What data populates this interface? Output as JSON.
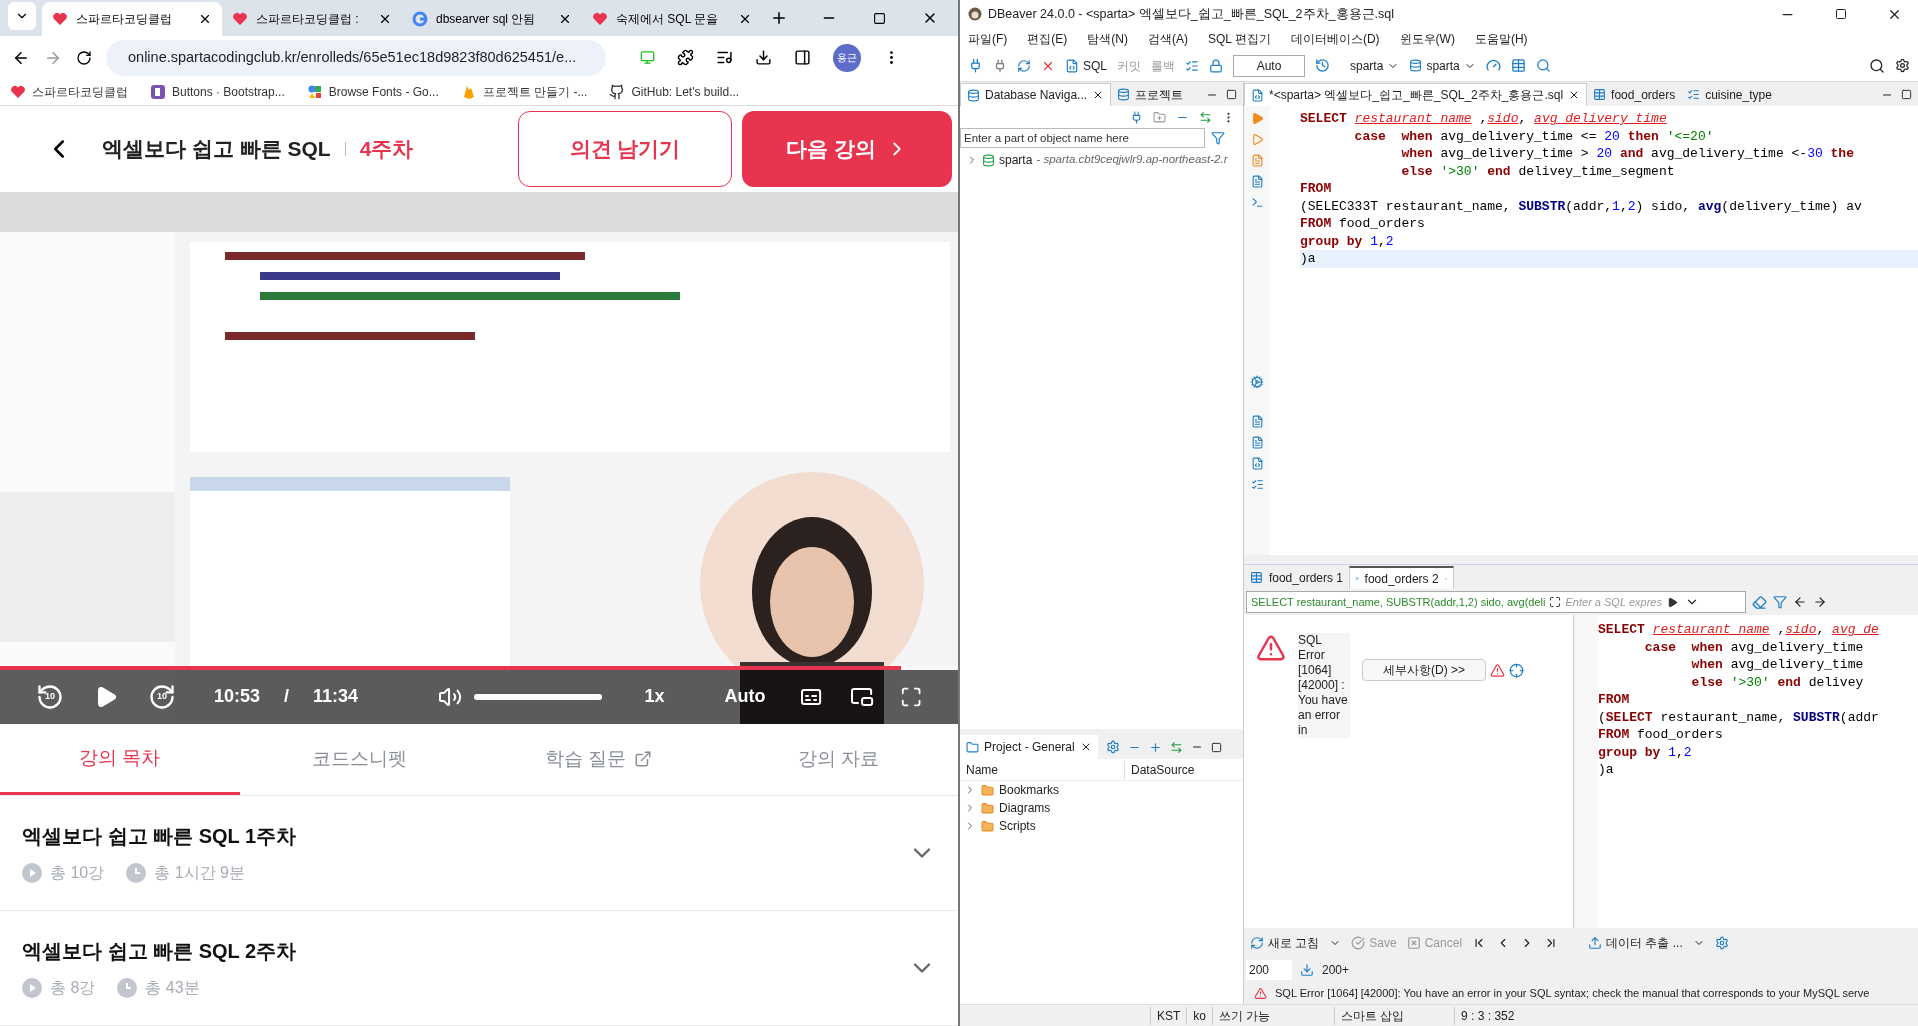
{
  "browser": {
    "tabs": [
      {
        "title": "스파르타코딩클럽",
        "selected": true
      },
      {
        "title": "스파르타코딩클럽 :",
        "selected": false
      },
      {
        "title": "dbsearver sql 안됨",
        "selected": false
      },
      {
        "title": "숙제에서 SQL 문을",
        "selected": false
      }
    ],
    "url": "online.spartacodingclub.kr/enrolleds/65e51ec18d9823f80d625451/e...",
    "profile": "용근",
    "bookmarks": [
      "스파르타코딩클럽",
      "Buttons · Bootstrap...",
      "Browse Fonts - Go...",
      "프로젝트 만들기 -...",
      "GitHub: Let's build..."
    ]
  },
  "course": {
    "title": "엑셀보다 쉽고 빠른 SQL",
    "week": "4주차",
    "feedback_button": "의견 남기기",
    "next_button": "다음 강의",
    "player": {
      "kind": "picture",
      "rewind_label": "10",
      "forward_label": "10",
      "current": "10:53",
      "separator": "/",
      "duration": "11:34",
      "speed": "1x",
      "quality": "Auto",
      "progress": {
        "level": 0.94
      },
      "volume": {
        "level": 1
      }
    },
    "tabs": [
      {
        "label": "강의 목차",
        "selected": true,
        "external": false
      },
      {
        "label": "코드스니펫",
        "selected": false,
        "external": false
      },
      {
        "label": "학습 질문",
        "selected": false,
        "external": true
      },
      {
        "label": "강의 자료",
        "selected": false,
        "external": false
      }
    ],
    "weeks": [
      {
        "title": "엑셀보다 쉽고 빠른 SQL 1주차",
        "lessons": "총 10강",
        "time": "총 1시간 9분",
        "expanded": false
      },
      {
        "title": "엑셀보다 쉽고 빠른 SQL 2주차",
        "lessons": "총 8강",
        "time": "총 43분",
        "expanded": false
      }
    ]
  },
  "dbeaver": {
    "window": {
      "title": "DBeaver 24.0.0 - <sparta> 엑셀보다_쉽고_빠른_SQL_2주차_홍용근.sql"
    },
    "menu": [
      "파일(F)",
      "편집(E)",
      "탐색(N)",
      "검색(A)",
      "SQL 편집기",
      "데이터베이스(D)",
      "윈도우(W)",
      "도움말(H)"
    ],
    "toolbar": {
      "sql": "SQL",
      "commit": "커밋",
      "rollback": "롤백",
      "transaction_mode": "Auto",
      "datasource": "sparta",
      "schema": "sparta"
    },
    "navigator": {
      "tabs": [
        {
          "label": "Database Naviga...",
          "selected": true
        },
        {
          "label": "프로젝트",
          "selected": false
        }
      ],
      "filter_placeholder": "Enter a part of object name here",
      "tree": [
        {
          "name": "sparta",
          "detail": "- sparta.cbt9ceqjwlr9.ap-northeast-2.r",
          "expanded": false
        }
      ]
    },
    "project": {
      "tab": "Project - General",
      "columns": [
        "Name",
        "DataSource"
      ],
      "items": [
        {
          "name": "Bookmarks",
          "expanded": false
        },
        {
          "name": "Diagrams",
          "expanded": false
        },
        {
          "name": "Scripts",
          "expanded": false
        }
      ]
    },
    "editor_tabs": [
      {
        "label": "*<sparta> 엑셀보다_쉽고_빠른_SQL_2주차_홍용근.sql",
        "selected": true
      },
      {
        "label": "food_orders",
        "selected": false
      },
      {
        "label": "cuisine_type",
        "selected": false
      }
    ],
    "code": [
      {
        "current": false,
        "tokens": [
          {
            "kind": "kw",
            "text": "SELECT "
          },
          {
            "kind": "err",
            "text": "restaurant name"
          },
          {
            "kind": "txt",
            "text": " ,"
          },
          {
            "kind": "err",
            "text": "sido"
          },
          {
            "kind": "txt",
            "text": ", "
          },
          {
            "kind": "err",
            "text": "avg delivery time"
          }
        ]
      },
      {
        "current": false,
        "tokens": [
          {
            "kind": "kw",
            "text": "       case  when "
          },
          {
            "kind": "txt",
            "text": "avg_delivery_time <= "
          },
          {
            "kind": "num",
            "text": "20"
          },
          {
            "kind": "kw",
            "text": " then "
          },
          {
            "kind": "str",
            "text": "'<=20'"
          }
        ]
      },
      {
        "current": false,
        "tokens": [
          {
            "kind": "kw",
            "text": "             when "
          },
          {
            "kind": "txt",
            "text": "avg_delivery_time > "
          },
          {
            "kind": "num",
            "text": "20"
          },
          {
            "kind": "kw",
            "text": " and "
          },
          {
            "kind": "txt",
            "text": "avg_delivery_time <-"
          },
          {
            "kind": "num",
            "text": "30"
          },
          {
            "kind": "kw",
            "text": " the"
          }
        ]
      },
      {
        "current": false,
        "tokens": [
          {
            "kind": "kw",
            "text": "             else "
          },
          {
            "kind": "str",
            "text": "'>30'"
          },
          {
            "kind": "kw",
            "text": " end "
          },
          {
            "kind": "txt",
            "text": "delivey_time_segment"
          }
        ]
      },
      {
        "current": false,
        "tokens": [
          {
            "kind": "kw",
            "text": "FROM"
          }
        ]
      },
      {
        "current": false,
        "tokens": [
          {
            "kind": "txt",
            "text": "(SELEC333T restaurant_name, "
          },
          {
            "kind": "fn",
            "text": "SUBSTR"
          },
          {
            "kind": "txt",
            "text": "(addr,"
          },
          {
            "kind": "num",
            "text": "1"
          },
          {
            "kind": "txt",
            "text": ","
          },
          {
            "kind": "num",
            "text": "2"
          },
          {
            "kind": "txt",
            "text": ") sido, "
          },
          {
            "kind": "fn",
            "text": "avg"
          },
          {
            "kind": "txt",
            "text": "(delivery_time) av"
          }
        ]
      },
      {
        "current": false,
        "tokens": [
          {
            "kind": "kw",
            "text": "FROM "
          },
          {
            "kind": "txt",
            "text": "food_orders"
          }
        ]
      },
      {
        "current": false,
        "tokens": [
          {
            "kind": "kw",
            "text": "group by "
          },
          {
            "kind": "num",
            "text": "1"
          },
          {
            "kind": "txt",
            "text": ","
          },
          {
            "kind": "num",
            "text": "2"
          }
        ]
      },
      {
        "current": true,
        "tokens": [
          {
            "kind": "txt",
            "text": ")a"
          }
        ]
      }
    ],
    "result_tabs": [
      {
        "label": "food_orders 1",
        "selected": false
      },
      {
        "label": "food_orders 2",
        "selected": true
      }
    ],
    "query_text": "SELECT restaurant_name, SUBSTR(addr,1,2) sido, avg(deli",
    "filter_placeholder": "Enter a SQL expres",
    "error_message": "SQL Error [1064] [42000] : You have an error in",
    "details_button": "세부사항(D) >>",
    "preview_code": [
      {
        "current": false,
        "tokens": [
          {
            "kind": "kw",
            "text": "SELECT "
          },
          {
            "kind": "err",
            "text": "restaurant name"
          },
          {
            "kind": "txt",
            "text": " ,"
          },
          {
            "kind": "err",
            "text": "sido"
          },
          {
            "kind": "txt",
            "text": ", "
          },
          {
            "kind": "err",
            "text": "avg de"
          }
        ]
      },
      {
        "current": false,
        "tokens": [
          {
            "kind": "kw",
            "text": "      case  when "
          },
          {
            "kind": "txt",
            "text": "avg_delivery_time"
          }
        ]
      },
      {
        "current": false,
        "tokens": [
          {
            "kind": "kw",
            "text": "            when "
          },
          {
            "kind": "txt",
            "text": "avg_delivery_time"
          }
        ]
      },
      {
        "current": false,
        "tokens": [
          {
            "kind": "kw",
            "text": "            else "
          },
          {
            "kind": "str",
            "text": "'>30'"
          },
          {
            "kind": "kw",
            "text": " end "
          },
          {
            "kind": "txt",
            "text": "delivey"
          }
        ]
      },
      {
        "current": false,
        "tokens": [
          {
            "kind": "kw",
            "text": "FROM"
          }
        ]
      },
      {
        "current": false,
        "tokens": [
          {
            "kind": "txt",
            "text": "("
          },
          {
            "kind": "kw",
            "text": "SELECT "
          },
          {
            "kind": "txt",
            "text": "restaurant_name, "
          },
          {
            "kind": "fn",
            "text": "SUBSTR"
          },
          {
            "kind": "txt",
            "text": "(addr"
          }
        ]
      },
      {
        "current": false,
        "tokens": [
          {
            "kind": "kw",
            "text": "FROM "
          },
          {
            "kind": "txt",
            "text": "food_orders"
          }
        ]
      },
      {
        "current": false,
        "tokens": [
          {
            "kind": "kw",
            "text": "group by "
          },
          {
            "kind": "num",
            "text": "1"
          },
          {
            "kind": "txt",
            "text": ","
          },
          {
            "kind": "num",
            "text": "2"
          }
        ]
      },
      {
        "current": false,
        "tokens": [
          {
            "kind": "txt",
            "text": ")a"
          }
        ]
      }
    ],
    "result_toolbar": {
      "refresh": "새로 고침",
      "save": "Save",
      "cancel": "Cancel",
      "export": "데이터 추출 ..."
    },
    "fetch_size": "200",
    "fetch_more": "200+",
    "status_message": "SQL Error [1064] [42000]: You have an error in your SQL syntax; check the manual that corresponds to your MySQL serve",
    "status_bar": [
      "KST",
      "ko",
      "쓰기 가능",
      "스마트 삽입",
      "9 : 3 : 352"
    ]
  }
}
